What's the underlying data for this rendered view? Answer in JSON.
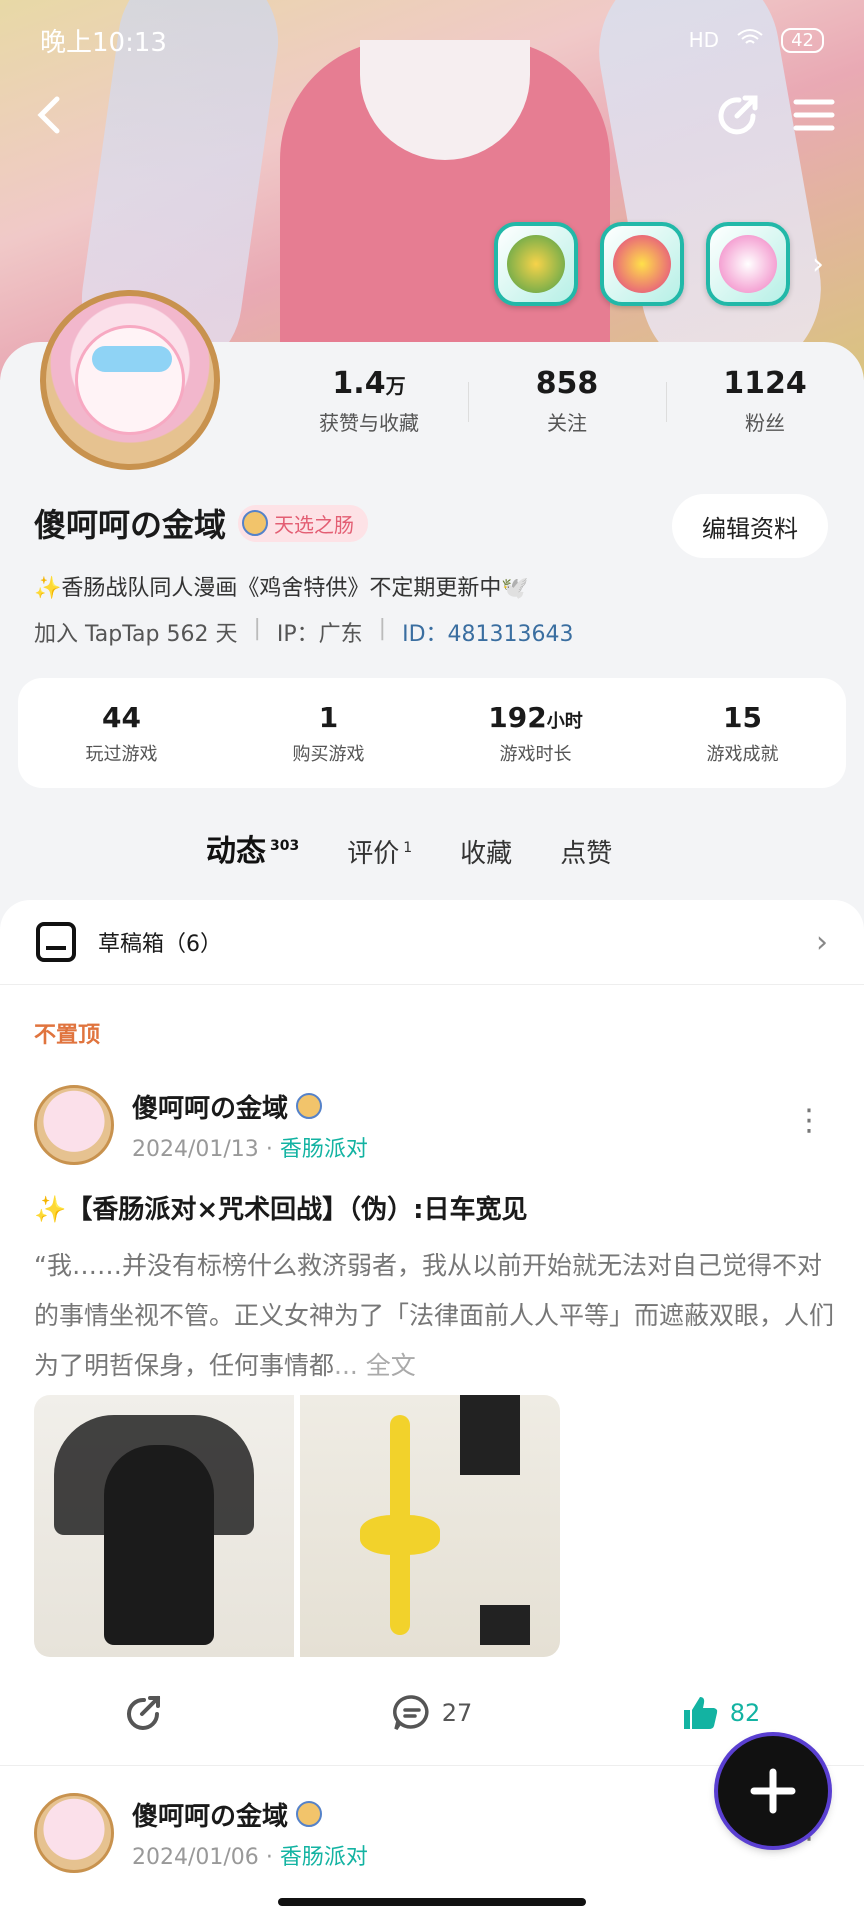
{
  "status_bar": {
    "time": "晚上10:13",
    "network": "HD",
    "battery": "42"
  },
  "profile": {
    "name": "傻呵呵の金域",
    "tag": "天选之肠",
    "edit_button": "编辑资料",
    "bio": "✨香肠战队同人漫画《鸡舍特供》不定期更新中🕊️",
    "joined": "加入 TapTap 562 天",
    "ip": "IP：广东",
    "id": "ID：481313643",
    "stats": [
      {
        "num": "1.4",
        "unit": "万",
        "label": "获赞与收藏"
      },
      {
        "num": "858",
        "unit": "",
        "label": "关注"
      },
      {
        "num": "1124",
        "unit": "",
        "label": "粉丝"
      }
    ]
  },
  "game_stats": [
    {
      "num": "44",
      "unit": "",
      "label": "玩过游戏"
    },
    {
      "num": "1",
      "unit": "",
      "label": "购买游戏"
    },
    {
      "num": "192",
      "unit": "小时",
      "label": "游戏时长"
    },
    {
      "num": "15",
      "unit": "",
      "label": "游戏成就"
    }
  ],
  "tabs": [
    {
      "label": "动态",
      "count": "303"
    },
    {
      "label": "评价",
      "count": "1"
    },
    {
      "label": "收藏",
      "count": ""
    },
    {
      "label": "点赞",
      "count": ""
    }
  ],
  "drafts": {
    "label": "草稿箱（6）"
  },
  "feed": {
    "pinned_label": "不置顶",
    "post1": {
      "author": "傻呵呵の金域",
      "date": "2024/01/13",
      "topic": "香肠派对",
      "title": "✨【香肠派对×咒术回战】（伪）:日车宽见",
      "text": "“我……并没有标榜什么救济弱者，我从以前开始就无法对自己觉得不对的事情坐视不管。正义女神为了「法律面前人人平等」而遮蔽双眼，人们为了明哲保身，任何事情都",
      "read_more": "... 全文",
      "comments": "27",
      "likes": "82"
    },
    "post2": {
      "author": "傻呵呵の金域",
      "date": "2024/01/06",
      "topic": "香肠派对"
    }
  },
  "icons": [
    "back-icon",
    "share-icon",
    "menu-icon",
    "inbox-icon",
    "chevron-right-icon",
    "more-icon",
    "comment-icon",
    "like-icon",
    "plus-icon"
  ],
  "colors": {
    "accent": "#13b3a2",
    "pinned": "#e0743e",
    "tag_text": "#e35e73"
  }
}
